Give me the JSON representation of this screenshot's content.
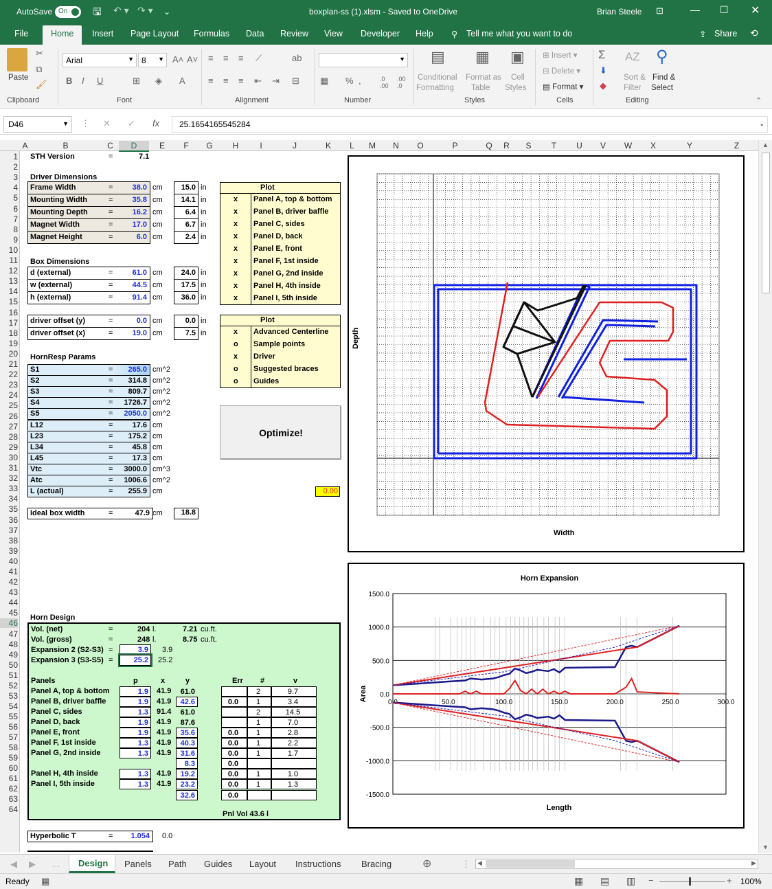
{
  "titlebar": {
    "autosave": "AutoSave",
    "toggle": "On",
    "file": "boxplan-ss (1).xlsm  -  Saved to OneDrive",
    "user": "Brian Steele"
  },
  "tabs": [
    "File",
    "Home",
    "Insert",
    "Page Layout",
    "Formulas",
    "Data",
    "Review",
    "View",
    "Developer",
    "Help"
  ],
  "tellme": "Tell me what you want to do",
  "share": "Share",
  "ribbon": {
    "paste": "Paste",
    "font_name": "Arial",
    "font_size": "8",
    "cond": "Conditional",
    "formatting": "Formatting",
    "format_as": "Format as",
    "table": "Table",
    "cell": "Cell",
    "styles": "Styles",
    "insert": "Insert",
    "delete": "Delete",
    "format": "Format",
    "sort": "Sort &",
    "filter": "Filter",
    "find": "Find &",
    "select": "Select",
    "groups": [
      "Clipboard",
      "Font",
      "Alignment",
      "Number",
      "Styles",
      "Cells",
      "Editing"
    ]
  },
  "formula": {
    "name_box": "D46",
    "fx": "fx",
    "value": "25.1654165545284"
  },
  "columns": [
    "A",
    "B",
    "C",
    "D",
    "E",
    "F",
    "G",
    "H",
    "I",
    "J",
    "K",
    "L",
    "M",
    "N",
    "O",
    "P",
    "Q",
    "R",
    "S",
    "T",
    "U",
    "V",
    "W",
    "X",
    "Y",
    "Z"
  ],
  "rows": [
    "1",
    "2",
    "3",
    "4",
    "5",
    "6",
    "7",
    "8",
    "9",
    "10",
    "11",
    "12",
    "13",
    "14",
    "15",
    "16",
    "17",
    "18",
    "19",
    "20",
    "21",
    "22",
    "23",
    "24",
    "25",
    "26",
    "27",
    "28",
    "29",
    "30",
    "31",
    "32",
    "33",
    "34",
    "35",
    "36",
    "37",
    "38",
    "39",
    "40",
    "41",
    "42",
    "43",
    "44",
    "45",
    "46",
    "47",
    "48",
    "49",
    "50",
    "51",
    "52",
    "53",
    "54",
    "55",
    "56",
    "57",
    "58",
    "59",
    "60",
    "61",
    "62",
    "63",
    "64"
  ],
  "sheet": {
    "sth_label": "STH Version",
    "sth_eq": "=",
    "sth_val": "7.1",
    "driver_title": "Driver Dimensions",
    "driver_rows": [
      {
        "label": "Frame Width",
        "val": "38.0",
        "unit": "cm",
        "in": "15.0",
        "iu": "in"
      },
      {
        "label": "Mounting Width",
        "val": "35.8",
        "unit": "cm",
        "in": "14.1",
        "iu": "in"
      },
      {
        "label": "Mounting Depth",
        "val": "16.2",
        "unit": "cm",
        "in": "6.4",
        "iu": "in"
      },
      {
        "label": "Magnet Width",
        "val": "17.0",
        "unit": "cm",
        "in": "6.7",
        "iu": "in"
      },
      {
        "label": "Magnet Height",
        "val": "6.0",
        "unit": "cm",
        "in": "2.4",
        "iu": "in"
      }
    ],
    "box_title": "Box Dimensions",
    "box_rows": [
      {
        "label": "d (external)",
        "val": "61.0",
        "unit": "cm",
        "in": "24.0",
        "iu": "in"
      },
      {
        "label": "w (external)",
        "val": "44.5",
        "unit": "cm",
        "in": "17.5",
        "iu": "in"
      },
      {
        "label": "h (external)",
        "val": "91.4",
        "unit": "cm",
        "in": "36.0",
        "iu": "in"
      }
    ],
    "offset_rows": [
      {
        "label": "driver offset (y)",
        "val": "0.0",
        "unit": "cm",
        "in": "0.0",
        "iu": "in"
      },
      {
        "label": "driver offset (x)",
        "val": "19.0",
        "unit": "cm",
        "in": "7.5",
        "iu": "in"
      }
    ],
    "hornresp_title": "HornResp Params",
    "hr_rows": [
      {
        "label": "S1",
        "val": "265.0",
        "unit": "cm^2"
      },
      {
        "label": "S2",
        "val": "314.8",
        "unit": "cm^2"
      },
      {
        "label": "S3",
        "val": "809.7",
        "unit": "cm^2"
      },
      {
        "label": "S4",
        "val": "1726.7",
        "unit": "cm^2"
      },
      {
        "label": "S5",
        "val": "2050.0",
        "unit": "cm^2"
      },
      {
        "label": "L12",
        "val": "17.6",
        "unit": "cm"
      },
      {
        "label": "L23",
        "val": "175.2",
        "unit": "cm"
      },
      {
        "label": "L34",
        "val": "45.8",
        "unit": "cm"
      },
      {
        "label": "L45",
        "val": "17.3",
        "unit": "cm"
      },
      {
        "label": "Vtc",
        "val": "3000.0",
        "unit": "cm^3"
      },
      {
        "label": "Atc",
        "val": "1006.6",
        "unit": "cm^2"
      },
      {
        "label": "L (actual)",
        "val": "255.9",
        "unit": "cm"
      }
    ],
    "ideal_label": "Ideal box width",
    "ideal_val": "47.9",
    "ideal_unit": "cm",
    "ideal_in": "18.8",
    "plot_title": "Plot",
    "plot1": [
      {
        "m": "x",
        "t": "Panel A, top & bottom"
      },
      {
        "m": "x",
        "t": "Panel B, driver baffle"
      },
      {
        "m": "x",
        "t": "Panel C, sides"
      },
      {
        "m": "x",
        "t": "Panel D, back"
      },
      {
        "m": "x",
        "t": "Panel E, front"
      },
      {
        "m": "x",
        "t": "Panel F, 1st inside"
      },
      {
        "m": "x",
        "t": "Panel G, 2nd inside"
      },
      {
        "m": "x",
        "t": "Panel H, 4th inside"
      },
      {
        "m": "x",
        "t": "Panel I, 5th inside"
      }
    ],
    "plot2_title": "Plot",
    "plot2": [
      {
        "m": "x",
        "t": "Advanced Centerline"
      },
      {
        "m": "o",
        "t": "Sample points"
      },
      {
        "m": "x",
        "t": "Driver"
      },
      {
        "m": "o",
        "t": "Suggested braces"
      },
      {
        "m": "o",
        "t": "Guides"
      }
    ],
    "optimize": "Optimize!",
    "yellow_val": "0.00",
    "horn_title": "Horn Design",
    "vol_net": "Vol. (net)",
    "vol_net_v": "204",
    "vol_net_u": "l.",
    "vol_net_cf": "7.21",
    "cf": "cu.ft.",
    "vol_gross": "Vol. (gross)",
    "vol_gross_v": "248",
    "vol_gross_u": "l.",
    "vol_gross_cf": "8.75",
    "exp2": "Expansion 2 (S2-S3)",
    "exp2_v": "3.9",
    "exp2_v2": "3.9",
    "exp3": "Expansion 3 (S3-S5)",
    "exp3_v": "25.2",
    "exp3_v2": "25.2",
    "panels_hdr": [
      "Panels",
      "p",
      "x",
      "y",
      "Err",
      "#",
      "v"
    ],
    "panel_rows": [
      {
        "n": "Panel A, top & bottom",
        "p": "1.9",
        "x": "41.9",
        "y": "61.0",
        "e": "",
        "h": "2",
        "v": "9.7"
      },
      {
        "n": "Panel B, driver baffle",
        "p": "1.9",
        "x": "41.9",
        "y": "42.6",
        "e": "0.0",
        "h": "1",
        "v": "3.4"
      },
      {
        "n": "Panel C, sides",
        "p": "1.3",
        "x": "91.4",
        "y": "61.0",
        "e": "",
        "h": "2",
        "v": "14.5"
      },
      {
        "n": "Panel D, back",
        "p": "1.9",
        "x": "41.9",
        "y": "87.6",
        "e": "",
        "h": "1",
        "v": "7.0"
      },
      {
        "n": "Panel E, front",
        "p": "1.9",
        "x": "41.9",
        "y": "35.6",
        "e": "0.0",
        "h": "1",
        "v": "2.8"
      },
      {
        "n": "Panel F, 1st inside",
        "p": "1.3",
        "x": "41.9",
        "y": "40.3",
        "e": "0.0",
        "h": "1",
        "v": "2.2"
      },
      {
        "n": "Panel G, 2nd inside",
        "p": "1.3",
        "x": "41.9",
        "y": "31.6",
        "e": "0.0",
        "h": "1",
        "v": "1.7"
      },
      {
        "n": "",
        "p": "",
        "x": "",
        "y": "8.3",
        "e": "0.0",
        "h": "",
        "v": ""
      },
      {
        "n": "Panel H, 4th inside",
        "p": "1.3",
        "x": "41.9",
        "y": "19.2",
        "e": "0.0",
        "h": "1",
        "v": "1.0"
      },
      {
        "n": "Panel I, 5th inside",
        "p": "1.3",
        "x": "41.9",
        "y": "23.2",
        "e": "0.0",
        "h": "1",
        "v": "1.3"
      },
      {
        "n": "",
        "p": "",
        "x": "",
        "y": "32.6",
        "e": "0.0",
        "h": "",
        "v": ""
      }
    ],
    "pnl_vol": "Pnl Vol   43.6  l",
    "hyper_label": "Hyperbolic T",
    "hyper_val": "1.054",
    "hyper_v2": "0.0"
  },
  "plot_chart": {
    "xlabel": "Width",
    "ylabel": "Depth"
  },
  "chart_data": {
    "type": "line",
    "title": "Horn Expansion",
    "xlabel": "Length",
    "ylabel": "Area",
    "xlim": [
      0,
      300
    ],
    "ylim": [
      -1500,
      1500
    ],
    "x_ticks": [
      "0.0",
      "50.0",
      "100.0",
      "150.0",
      "200.0",
      "250.0",
      "300.0"
    ],
    "y_ticks": [
      "1500.0",
      "1000.0",
      "500.0",
      "0.0",
      "-500.0",
      "-1000.0",
      "-1500.0"
    ],
    "series": [
      {
        "color": "#1a1a8c",
        "x": [
          0,
          20,
          50,
          65,
          70,
          80,
          90,
          95,
          100,
          105,
          110,
          115,
          120,
          125,
          130,
          135,
          140,
          145,
          150,
          155,
          200,
          210,
          215,
          220,
          258
        ],
        "y": [
          130,
          150,
          185,
          200,
          230,
          215,
          230,
          250,
          280,
          300,
          380,
          350,
          310,
          330,
          360,
          350,
          340,
          370,
          320,
          390,
          400,
          700,
          720,
          700,
          1020
        ]
      },
      {
        "color": "#1a1a8c",
        "x": [
          0,
          20,
          50,
          65,
          70,
          80,
          90,
          95,
          100,
          105,
          110,
          115,
          120,
          125,
          130,
          135,
          140,
          145,
          150,
          155,
          200,
          210,
          215,
          220,
          258
        ],
        "y": [
          -130,
          -150,
          -185,
          -200,
          -230,
          -215,
          -230,
          -250,
          -280,
          -300,
          -380,
          -350,
          -310,
          -330,
          -360,
          -350,
          -340,
          -370,
          -320,
          -390,
          -400,
          -700,
          -720,
          -700,
          -1020
        ]
      },
      {
        "color": "#e02020",
        "x": [
          0,
          60,
          65,
          70,
          75,
          80,
          90,
          100,
          105,
          110,
          115,
          120,
          125,
          130,
          135,
          140,
          145,
          150,
          155,
          160,
          200,
          210,
          215,
          220,
          258
        ],
        "y": [
          0,
          0,
          40,
          0,
          40,
          0,
          0,
          0,
          80,
          200,
          50,
          0,
          70,
          0,
          70,
          0,
          40,
          0,
          40,
          0,
          0,
          100,
          230,
          30,
          0
        ]
      },
      {
        "color": "#e02020",
        "x": [
          0,
          220,
          258
        ],
        "y": [
          130,
          700,
          1020
        ]
      },
      {
        "color": "#e02020",
        "x": [
          0,
          220,
          258
        ],
        "y": [
          -130,
          -700,
          -1020
        ]
      },
      {
        "color": "#e02020",
        "dash": true,
        "x": [
          0,
          258
        ],
        "y": [
          130,
          1020
        ]
      },
      {
        "color": "#e02020",
        "dash": true,
        "x": [
          0,
          258
        ],
        "y": [
          -130,
          -1020
        ]
      },
      {
        "color": "#2020c0",
        "dash": true,
        "x": [
          0,
          100,
          200,
          258
        ],
        "y": [
          130,
          330,
          700,
          1020
        ]
      },
      {
        "color": "#2020c0",
        "dash": true,
        "x": [
          0,
          100,
          200,
          258
        ],
        "y": [
          -130,
          -330,
          -700,
          -1020
        ]
      }
    ]
  },
  "sheet_tabs": [
    "Design",
    "Panels",
    "Path",
    "Guides",
    "Layout",
    "Instructions",
    "Bracing"
  ],
  "status": {
    "ready": "Ready",
    "zoom": "100%"
  }
}
